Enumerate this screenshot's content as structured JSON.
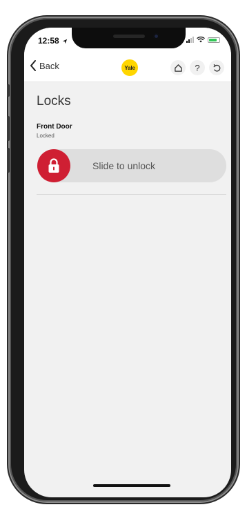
{
  "status_bar": {
    "time": "12:58",
    "icons": [
      "location-arrow-icon",
      "signal-icon",
      "wifi-icon",
      "battery-charging-icon"
    ]
  },
  "nav": {
    "back_label": "Back",
    "logo_text": "Yale",
    "icons": [
      "home-icon",
      "help-icon",
      "refresh-icon"
    ],
    "help_glyph": "?"
  },
  "page": {
    "title": "Locks"
  },
  "lock": {
    "name": "Front Door",
    "status": "Locked",
    "slider_label": "Slide to unlock",
    "slider_progress": 0
  },
  "colors": {
    "accent_red": "#cf1f33",
    "logo_yellow": "#ffd600",
    "background": "#f1f1f1",
    "battery_green": "#35c759"
  }
}
